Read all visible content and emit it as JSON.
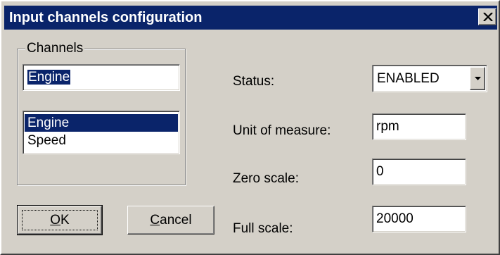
{
  "window": {
    "title": "Input channels configuration",
    "close_icon": "close-icon"
  },
  "channels_group": {
    "legend": "Channels",
    "name_value": "Engine",
    "list_items": [
      "Engine",
      "Speed"
    ],
    "selected_index": 0
  },
  "fields": {
    "status_label": "Status:",
    "status_value": "ENABLED",
    "status_dropdown_icon": "chevron-down-icon",
    "unit_label": "Unit of measure:",
    "unit_value": "rpm",
    "zero_label": "Zero scale:",
    "zero_value": "0",
    "full_label": "Full scale:",
    "full_value": "20000"
  },
  "buttons": {
    "ok_mnemonic": "O",
    "ok_rest": "K",
    "cancel_mnemonic": "C",
    "cancel_rest": "ancel"
  },
  "colors": {
    "titlebar": "#0a246a",
    "face": "#d4d0c8",
    "selection": "#0a246a"
  }
}
